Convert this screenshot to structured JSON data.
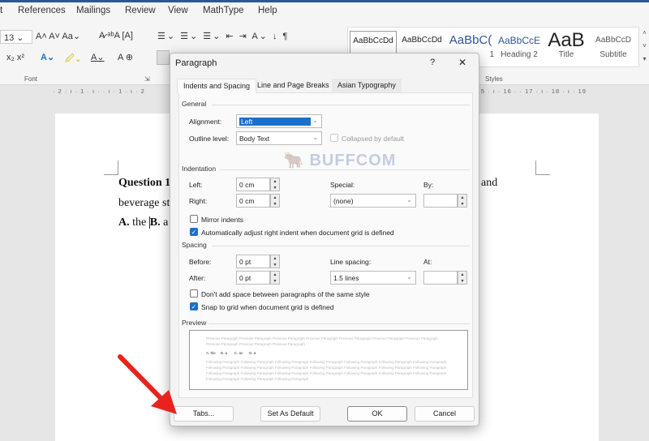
{
  "menu": [
    "t",
    "References",
    "Mailings",
    "Review",
    "View",
    "MathType",
    "Help"
  ],
  "font": {
    "size": "13",
    "group_label": "Font"
  },
  "paragraph_group_label": "Paragraph",
  "styles": {
    "group_label": "Styles",
    "items": [
      {
        "sample": "AaBbCcDd",
        "name": ""
      },
      {
        "sample": "AaBbCcDd",
        "name": ""
      },
      {
        "sample": "AaBbC(",
        "name": "1"
      },
      {
        "sample": "AaBbCcE",
        "name": "Heading 2"
      },
      {
        "sample": "AaB",
        "name": "Title"
      },
      {
        "sample": "AaBbCcD",
        "name": "Subtitle"
      }
    ]
  },
  "ruler": {
    "left": "· 2 · ı · 1 · ı ·   · ı · 1 · ı · 2",
    "right": "ı · 15 · ı · 16 ·   · 17 · ı · 18 · ı · 19"
  },
  "document": {
    "line1_bold": "Question 1",
    "line1_end": "and",
    "line2": "beverage st",
    "line3_a": "A.",
    "line3_a_text": " the ",
    "line3_b": "B.",
    "line3_b_text": " a"
  },
  "watermark": "BUFFCOM",
  "dialog": {
    "title": "Paragraph",
    "help": "?",
    "close": "✕",
    "tabs": [
      "Indents and Spacing",
      "Line and Page Breaks",
      "Asian Typography"
    ],
    "general": {
      "heading": "General",
      "alignment_label": "Alignment:",
      "alignment": "Left",
      "outline_label": "Outline level:",
      "outline": "Body Text",
      "collapsed_label": "Collapsed by default"
    },
    "indentation": {
      "heading": "Indentation",
      "left_label": "Left:",
      "left": "0 cm",
      "right_label": "Right:",
      "right": "0 cm",
      "special_label": "Special:",
      "special": "(none)",
      "by_label": "By:",
      "by": "",
      "mirror_label": "Mirror indents",
      "mirror": false,
      "auto_label": "Automatically adjust right indent when document grid is defined",
      "auto": true
    },
    "spacing": {
      "heading": "Spacing",
      "before_label": "Before:",
      "before": "0 pt",
      "after_label": "After:",
      "after": "0 pt",
      "line_label": "Line spacing:",
      "line": "1.5 lines",
      "at_label": "At:",
      "at": "",
      "dont_add_label": "Don't add space between paragraphs of the same style",
      "dont_add": false,
      "snap_label": "Snap to grid when document grid is defined",
      "snap": true
    },
    "preview": {
      "heading": "Preview",
      "previous": "Previous Paragraph Previous Paragraph Previous Paragraph Previous Paragraph Previous Paragraph Previous Paragraph Previous Paragraph Previous Paragraph Previous Paragraph Previous Paragraph",
      "sample": "A. the     B. a       C. an      D. ø",
      "following": "Following Paragraph Following Paragraph Following Paragraph Following Paragraph Following Paragraph Following Paragraph Following Paragraph Following Paragraph Following Paragraph Following Paragraph Following Paragraph Following Paragraph Following Paragraph Following Paragraph Following Paragraph Following Paragraph Following Paragraph Following Paragraph Following Paragraph Following Paragraph Following Paragraph Following Paragraph Following Paragraph Following Paragraph"
    },
    "buttons": {
      "tabs": "Tabs...",
      "default": "Set As Default",
      "ok": "OK",
      "cancel": "Cancel"
    }
  },
  "colors": {
    "accent": "#1a6fc9",
    "arrow": "#e8231d"
  }
}
